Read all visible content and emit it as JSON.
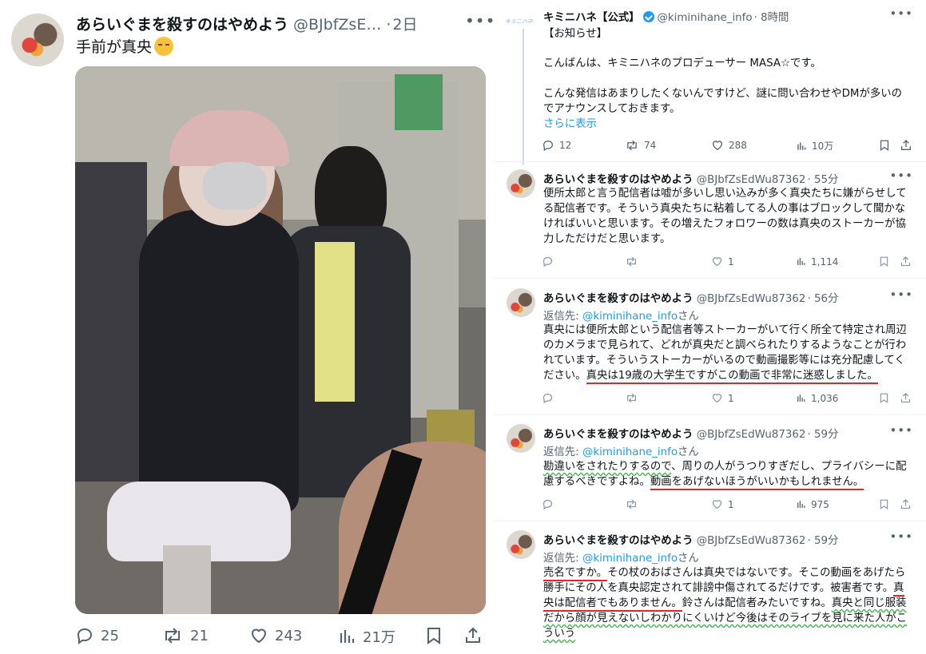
{
  "left_post": {
    "author_name": "あらいぐまを殺すのはやめよう",
    "handle": "@BJbfZsE…",
    "separator": "·",
    "time": "2日",
    "more": "•••",
    "text": "手前が真央",
    "actions": {
      "replies": "25",
      "reposts": "21",
      "likes": "243",
      "views": "21万"
    }
  },
  "right_thread": {
    "main": {
      "name": "キミニハネ【公式】",
      "handle": "@kiminihane_info",
      "time": "· 8時間",
      "logo_text": "キミニハネ",
      "more": "•••",
      "line1": "【お知らせ】",
      "line2": "こんばんは、キミニハネのプロデューサー MASA☆です。",
      "line3": "こんな発信はあまりしたくないんですけど、謎に問い合わせやDMが多いの",
      "line4": "でアナウンスしておきます。",
      "show_more": "さらに表示",
      "actions": {
        "replies": "12",
        "reposts": "74",
        "likes": "288",
        "views": "10万"
      }
    },
    "replies": [
      {
        "name": "あらいぐまを殺すのはやめよう",
        "handle": "@BJbfZsEdWu87362",
        "time": "· 55分",
        "more": "•••",
        "lines": [
          "便所太郎と言う配信者は嘘が多いし思い込みが多く真央たちに嫌がらせして",
          "る配信者です。そういう真央たちに粘着してる人の事はブロックして聞かな",
          "ければいいと思います。その増えたフォロワーの数は真央のストーカーが協",
          "力しただけだと思います。"
        ],
        "actions": {
          "likes": "1",
          "views": "1,114"
        }
      },
      {
        "name": "あらいぐまを殺すのはやめよう",
        "handle": "@BJbfZsEdWu87362",
        "time": "· 56分",
        "more": "•••",
        "reply_label": "返信先:",
        "reply_handle": "@kiminihane_info",
        "reply_suffix": "さん",
        "lines": [
          "真央には便所太郎という配信者等ストーカーがいて行く所全て特定され周辺",
          "のカメラまで見られて、どれが真央だと調べられたりするようなことが行わ",
          "れています。そういうストーカーがいるので動画撮影等には充分配慮してく",
          "ださい。"
        ],
        "underlined": "真央は19歳の大学生ですがこの動画で非常に迷惑しました。",
        "actions": {
          "likes": "1",
          "views": "1,036"
        }
      },
      {
        "name": "あらいぐまを殺すのはやめよう",
        "handle": "@BJbfZsEdWu87362",
        "time": "· 59分",
        "more": "•••",
        "reply_label": "返信先:",
        "reply_handle": "@kiminihane_info",
        "reply_suffix": "さん",
        "line1_green": "勘違いをされたりするので",
        "line1_rest": "、周りの人がうつりすぎだし、プライバシーに配",
        "line2_start": "慮するべきですよね。",
        "line2_red": "動画をあげないほうがいいかもしれません。",
        "actions": {
          "likes": "1",
          "views": "975"
        }
      },
      {
        "name": "あらいぐまを殺すのはやめよう",
        "handle": "@BJbfZsEdWu87362",
        "time": "· 59分",
        "more": "•••",
        "reply_label": "返信先:",
        "reply_handle": "@kiminihane_info",
        "reply_suffix": "さん",
        "l1_red": "売名ですか。",
        "l1_rest": "その杖のおばさんは真央ではないです。そこの動画をあげたら",
        "l2": "勝手にその人を真央認定されて誹謗中傷されてるだけです。被害者です。",
        "l2_red": "真",
        "l3_red": "央は配信者でもありません。",
        "l3_rest": "鈴さんは配信者みたいですね。",
        "l3_green": "真央と同じ服装",
        "l4_green": "だから顔が見えないしわかりにくいけど今後はそのライブを見に来た人がこ",
        "l5_green": "ういう"
      }
    ]
  }
}
